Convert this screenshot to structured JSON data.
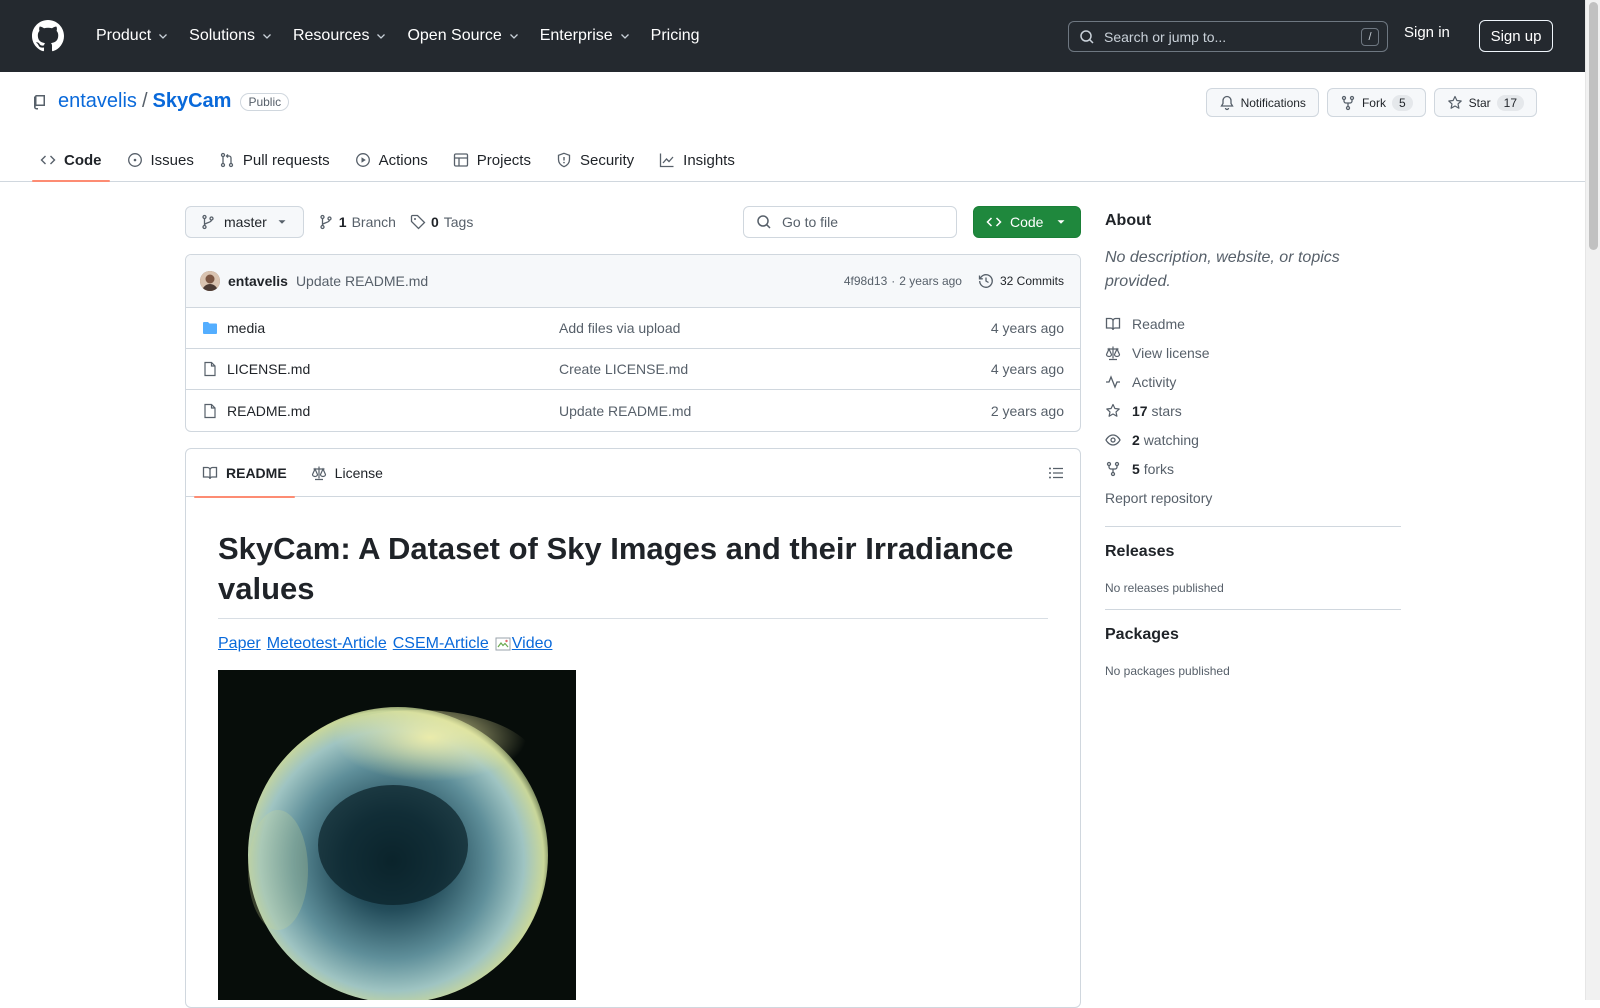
{
  "header": {
    "nav": [
      {
        "label": "Product",
        "dropdown": true
      },
      {
        "label": "Solutions",
        "dropdown": true
      },
      {
        "label": "Resources",
        "dropdown": true
      },
      {
        "label": "Open Source",
        "dropdown": true
      },
      {
        "label": "Enterprise",
        "dropdown": true
      },
      {
        "label": "Pricing",
        "dropdown": false
      }
    ],
    "search_placeholder": "Search or jump to...",
    "search_shortcut": "/",
    "sign_in": "Sign in",
    "sign_up": "Sign up"
  },
  "repo": {
    "owner": "entavelis",
    "separator": "/",
    "name": "SkyCam",
    "visibility": "Public",
    "notifications_label": "Notifications",
    "fork_label": "Fork",
    "fork_count": "5",
    "star_label": "Star",
    "star_count": "17",
    "tabs": [
      {
        "label": "Code",
        "icon": "code-icon",
        "active": true
      },
      {
        "label": "Issues",
        "icon": "issue-icon",
        "active": false
      },
      {
        "label": "Pull requests",
        "icon": "pull-request-icon",
        "active": false
      },
      {
        "label": "Actions",
        "icon": "play-icon",
        "active": false
      },
      {
        "label": "Projects",
        "icon": "table-icon",
        "active": false
      },
      {
        "label": "Security",
        "icon": "shield-icon",
        "active": false
      },
      {
        "label": "Insights",
        "icon": "graph-icon",
        "active": false
      }
    ]
  },
  "file_nav": {
    "branch": "master",
    "branch_count": "1",
    "branch_label": "Branch",
    "tag_count": "0",
    "tag_label": "Tags",
    "go_to_file": "Go to file",
    "code_button": "Code"
  },
  "latest_commit": {
    "author": "entavelis",
    "message": "Update README.md",
    "hash": "4f98d13",
    "age": "2 years ago",
    "commits_label": "32 Commits"
  },
  "files": [
    {
      "name": "media",
      "type": "folder",
      "commit": "Add files via upload",
      "age": "4 years ago"
    },
    {
      "name": "LICENSE.md",
      "type": "file",
      "commit": "Create LICENSE.md",
      "age": "4 years ago"
    },
    {
      "name": "README.md",
      "type": "file",
      "commit": "Update README.md",
      "age": "2 years ago"
    }
  ],
  "readme": {
    "tabs": [
      {
        "label": "README",
        "icon": "book-icon",
        "active": true
      },
      {
        "label": "License",
        "icon": "law-icon",
        "active": false
      }
    ],
    "title": "SkyCam: A Dataset of Sky Images and their Irradiance values",
    "links": [
      "Paper",
      "Meteotest-Article",
      "CSEM-Article"
    ],
    "video_alt": "Video"
  },
  "sidebar": {
    "about_heading": "About",
    "about_desc": "No description, website, or topics provided.",
    "items": [
      {
        "icon": "book-icon",
        "bold": "",
        "label": "Readme"
      },
      {
        "icon": "law-icon",
        "bold": "",
        "label": "View license"
      },
      {
        "icon": "pulse-icon",
        "bold": "",
        "label": "Activity"
      },
      {
        "icon": "star-icon",
        "bold": "17",
        "label": "stars"
      },
      {
        "icon": "eye-icon",
        "bold": "2",
        "label": "watching"
      },
      {
        "icon": "fork-icon",
        "bold": "5",
        "label": "forks"
      }
    ],
    "report": "Report repository",
    "releases_heading": "Releases",
    "releases_empty": "No releases published",
    "packages_heading": "Packages",
    "packages_empty": "No packages published"
  },
  "colors": {
    "header_bg": "#24292f",
    "link": "#0969da",
    "code_button": "#1f883d",
    "active_tab_underline": "#fd8c73",
    "folder": "#54aeff"
  }
}
